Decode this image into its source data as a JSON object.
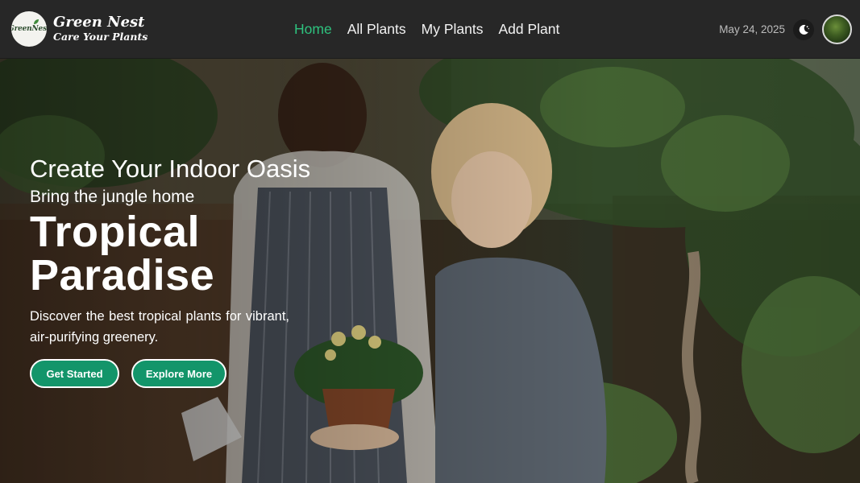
{
  "brand": {
    "logo_text": "GreenNest",
    "name": "Green Nest",
    "tagline": "Care Your Plants"
  },
  "nav": {
    "links": [
      {
        "label": "Home",
        "active": true
      },
      {
        "label": "All Plants",
        "active": false
      },
      {
        "label": "My Plants",
        "active": false
      },
      {
        "label": "Add Plant",
        "active": false
      }
    ],
    "date": "May 24, 2025",
    "theme_icon": "moon-icon",
    "accent_color": "#2ec27e"
  },
  "hero": {
    "title": "Create Your Indoor Oasis",
    "subtitle": "Bring the jungle home",
    "heading": "Tropical Paradise",
    "description": "Discover the best tropical plants for vibrant, air-purifying greenery.",
    "primary_button": "Get Started",
    "secondary_button": "Explore More",
    "button_color": "#13956a"
  }
}
